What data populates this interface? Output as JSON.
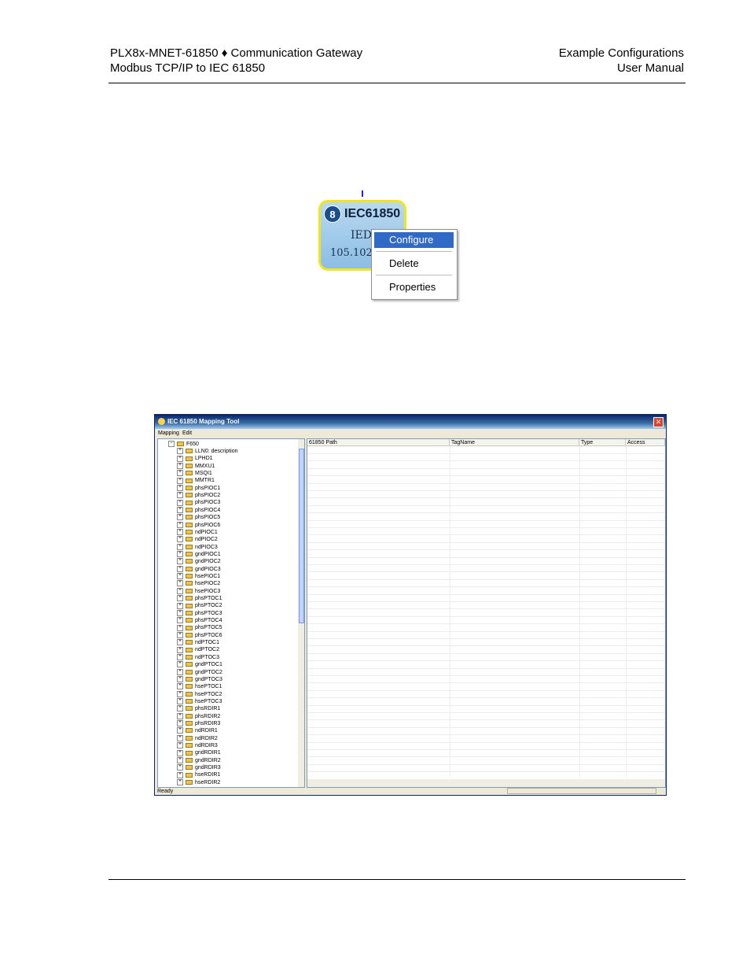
{
  "header": {
    "left_line1": "PLX8x-MNET-61850 ♦ Communication Gateway",
    "left_line2": "Modbus TCP/IP to IEC 61850",
    "right_line1": "Example Configurations",
    "right_line2": "User Manual"
  },
  "iec_node": {
    "title": "IEC61850",
    "line1": "IED",
    "line2": "105.102.0"
  },
  "context_menu": {
    "items": [
      "Configure",
      "Delete",
      "Properties"
    ],
    "selected": "Configure",
    "accent": "#3169c6"
  },
  "mapping_tool": {
    "title": "IEC 61850 Mapping Tool",
    "menu": [
      "Mapping",
      "Edit"
    ],
    "tree_root": "F650",
    "tree_items": [
      "LLN0: description",
      "LPHD1",
      "MMXU1",
      "MSQI1",
      "MMTR1",
      "phsPIOC1",
      "phsPIOC2",
      "phsPIOC3",
      "phsPIOC4",
      "phsPIOC5",
      "phsPIOC6",
      "ndPIOC1",
      "ndPIOC2",
      "ndPIOC3",
      "gndPIOC1",
      "gndPIOC2",
      "gndPIOC3",
      "hsePIOC1",
      "hsePIOC2",
      "hsePIOC3",
      "phsPTOC1",
      "phsPTOC2",
      "phsPTOC3",
      "phsPTOC4",
      "phsPTOC5",
      "phsPTOC6",
      "ndPTOC1",
      "ndPTOC2",
      "ndPTOC3",
      "gndPTOC1",
      "gndPTOC2",
      "gndPTOC3",
      "hsePTOC1",
      "hsePTOC2",
      "hsePTOC3",
      "phsRDIR1",
      "phsRDIR2",
      "phsRDIR3",
      "ndRDIR1",
      "ndRDIR2",
      "ndRDIR3",
      "gndRDIR1",
      "gndRDIR2",
      "gndRDIR3",
      "hseRDIR1",
      "hseRDIR2"
    ],
    "columns": [
      "61850 Path",
      "TagName",
      "Type",
      "Access"
    ],
    "status": "Ready"
  }
}
